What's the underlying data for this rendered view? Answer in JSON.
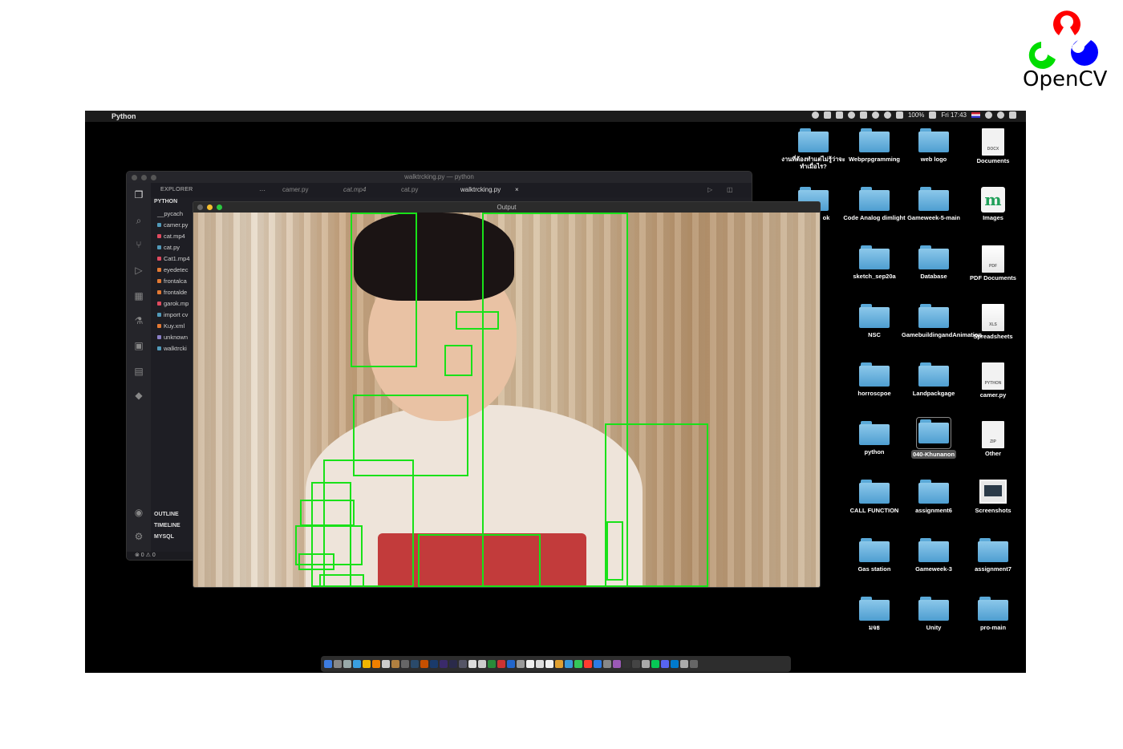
{
  "logo": {
    "text": "OpenCV",
    "colors": [
      "#ff0000",
      "#00cc00",
      "#0000ff"
    ]
  },
  "menubar": {
    "app_name": "Python",
    "battery": "100%",
    "clock": "Fri 17:43"
  },
  "vscode": {
    "window_title": "walktrcking.py — python",
    "explorer_label": "EXPLORER",
    "tabs": [
      "camer.py",
      "cat.mp4",
      "cat.py",
      "walktrcking.py"
    ],
    "section_python": "PYTHON",
    "files": [
      "__pycach",
      "camer.py",
      "cat.mp4",
      "cat.py",
      "Cat1.mp4",
      "eyedetec",
      "frontalca",
      "frontalde",
      "garok.mp",
      "import cv",
      "Kuy.xml",
      "unknown",
      "walktrcki"
    ],
    "section_outline": "OUTLINE",
    "section_timeline": "TIMELINE",
    "section_mysql": "MYSQL",
    "status": "⊗ 0 ⚠ 0",
    "badge": "1"
  },
  "output_window": {
    "title": "Output"
  },
  "desktop_icons": [
    "งานที่ต้องทำแต่ไม่รู้ว่าจะทำเมื่อไร?",
    "Webprpgramming",
    "web logo",
    "Documents",
    "ok",
    "Code Analog dimlight",
    "Gameweek-5-main",
    "Images",
    "sketch_sep20a",
    "Database",
    "PDF Documents",
    "NSC",
    "GamebuildingandAnimation",
    "Spreadsheets",
    "horroscpoe",
    "Landpackgage",
    "camer.py",
    "python",
    "040-Khunanon",
    "Other",
    "CALL FUNCTION",
    "assignment6",
    "Screenshots",
    "Gas station",
    "Gameweek-3",
    "assignment7",
    "มจธ",
    "Unity",
    "pro-main"
  ]
}
